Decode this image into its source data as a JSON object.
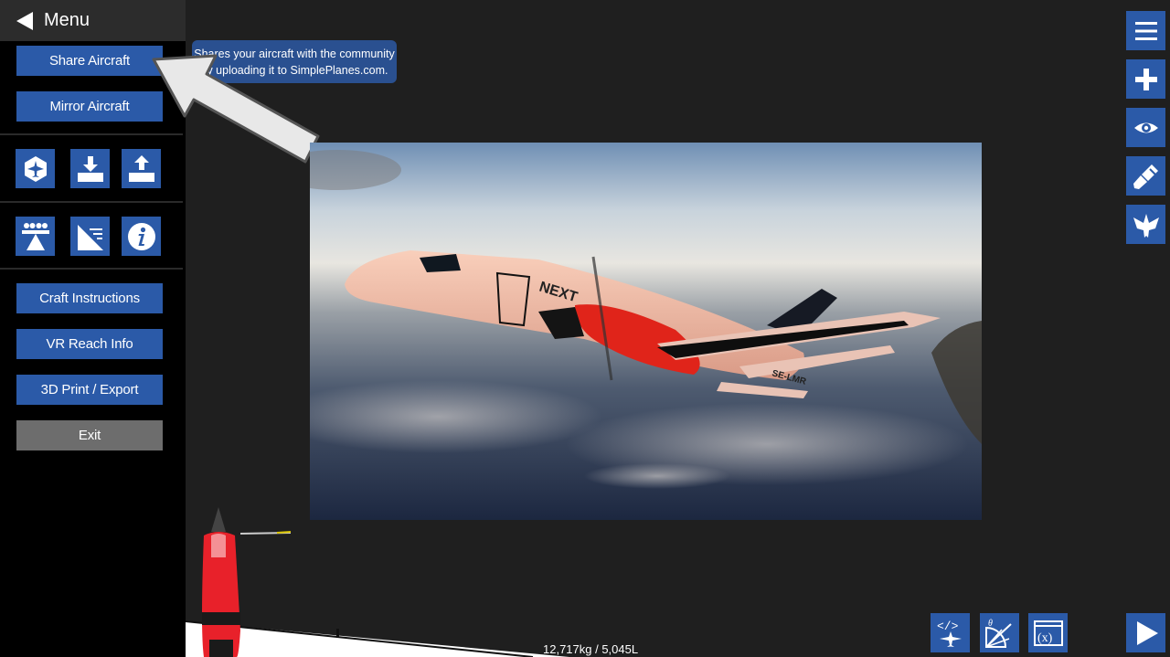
{
  "menu": {
    "title": "Menu"
  },
  "buttons": {
    "share": "Share Aircraft",
    "mirror": "Mirror Aircraft",
    "craft_instructions": "Craft Instructions",
    "vr_reach": "VR Reach Info",
    "print_export": "3D Print / Export",
    "exit": "Exit"
  },
  "tooltip": {
    "line1": "Shares your aircraft with the community",
    "line2": "by uploading it to SimplePlanes.com."
  },
  "aircraft": {
    "livery_text": "NEXT",
    "registration": "SE-LMR"
  },
  "status": {
    "mass": "12,717kg / 5,045L"
  },
  "colors": {
    "accent": "#2b5aa8",
    "exit": "#6d6d6d",
    "sidebar": "#000000",
    "workspace": "#1f1f1f"
  },
  "icons": [
    "aircraft-icon",
    "download-icon",
    "upload-icon",
    "passengers-icon",
    "cockpit-icon",
    "info-icon",
    "hamburger-icon",
    "plus-icon",
    "eye-icon",
    "paint-brush-icon",
    "wing-icon",
    "code-plane-icon",
    "gauge-icon",
    "variables-icon",
    "play-icon"
  ]
}
